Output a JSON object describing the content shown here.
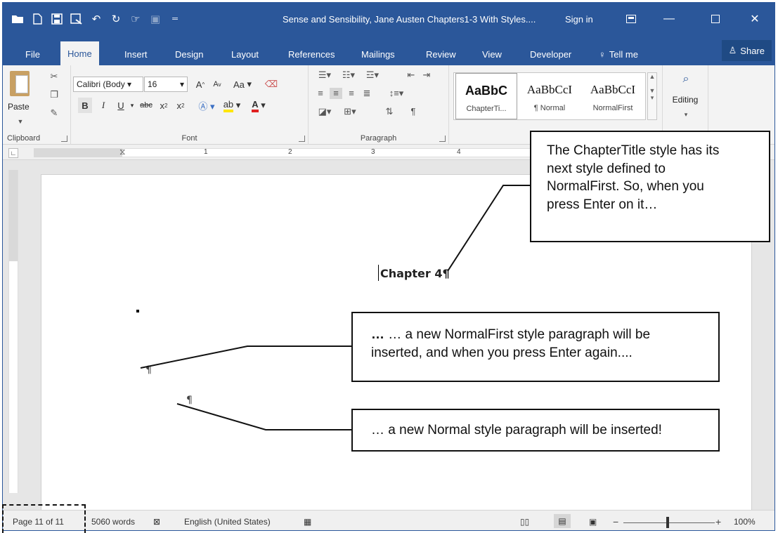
{
  "title_bar": {
    "document_title": "Sense and Sensibility, Jane Austen Chapters1-3 With Styles....",
    "sign_in": "Sign in",
    "qat_icons": [
      "folder-icon",
      "new-doc-icon",
      "save-icon",
      "save-as-icon",
      "undo-icon",
      "redo-icon",
      "touch-mode-icon",
      "customize-icon"
    ]
  },
  "tabs": [
    {
      "label": "File",
      "active": false
    },
    {
      "label": "Home",
      "active": true
    },
    {
      "label": "Insert",
      "active": false
    },
    {
      "label": "Design",
      "active": false
    },
    {
      "label": "Layout",
      "active": false
    },
    {
      "label": "References",
      "active": false
    },
    {
      "label": "Mailings",
      "active": false
    },
    {
      "label": "Review",
      "active": false
    },
    {
      "label": "View",
      "active": false
    },
    {
      "label": "Developer",
      "active": false
    }
  ],
  "tell_me": "Tell me",
  "share": "Share",
  "ribbon": {
    "clipboard": {
      "paste": "Paste",
      "label": "Clipboard"
    },
    "font": {
      "name": "Calibri (Body",
      "size": "16",
      "label": "Font",
      "case_button": "Aa"
    },
    "paragraph": {
      "label": "Paragraph"
    },
    "styles": [
      {
        "preview": "AaBbC",
        "name": "ChapterTi..."
      },
      {
        "preview": "AaBbCcI",
        "name": "¶ Normal"
      },
      {
        "preview": "AaBbCcI",
        "name": "NormalFirst"
      }
    ],
    "editing": {
      "label": "Editing"
    }
  },
  "ruler": {
    "numbers": [
      "1",
      "2",
      "3",
      "4"
    ]
  },
  "document": {
    "chapter_heading": "Chapter 4¶",
    "pilcrow": "¶"
  },
  "callouts": {
    "top": [
      "The ChapterTitle style has its",
      "next style defined to",
      "NormalFirst. So, when you",
      "press Enter on it…"
    ],
    "middle": [
      "… a new NormalFirst style paragraph will be",
      "inserted, and when you press Enter again...."
    ],
    "bottom": [
      "… a new Normal style paragraph will be inserted!"
    ]
  },
  "status_bar": {
    "page": "Page 11 of 11",
    "words": "5060 words",
    "language": "English (United States)",
    "zoom": "100%"
  },
  "colors": {
    "accent": "#2b579a"
  }
}
